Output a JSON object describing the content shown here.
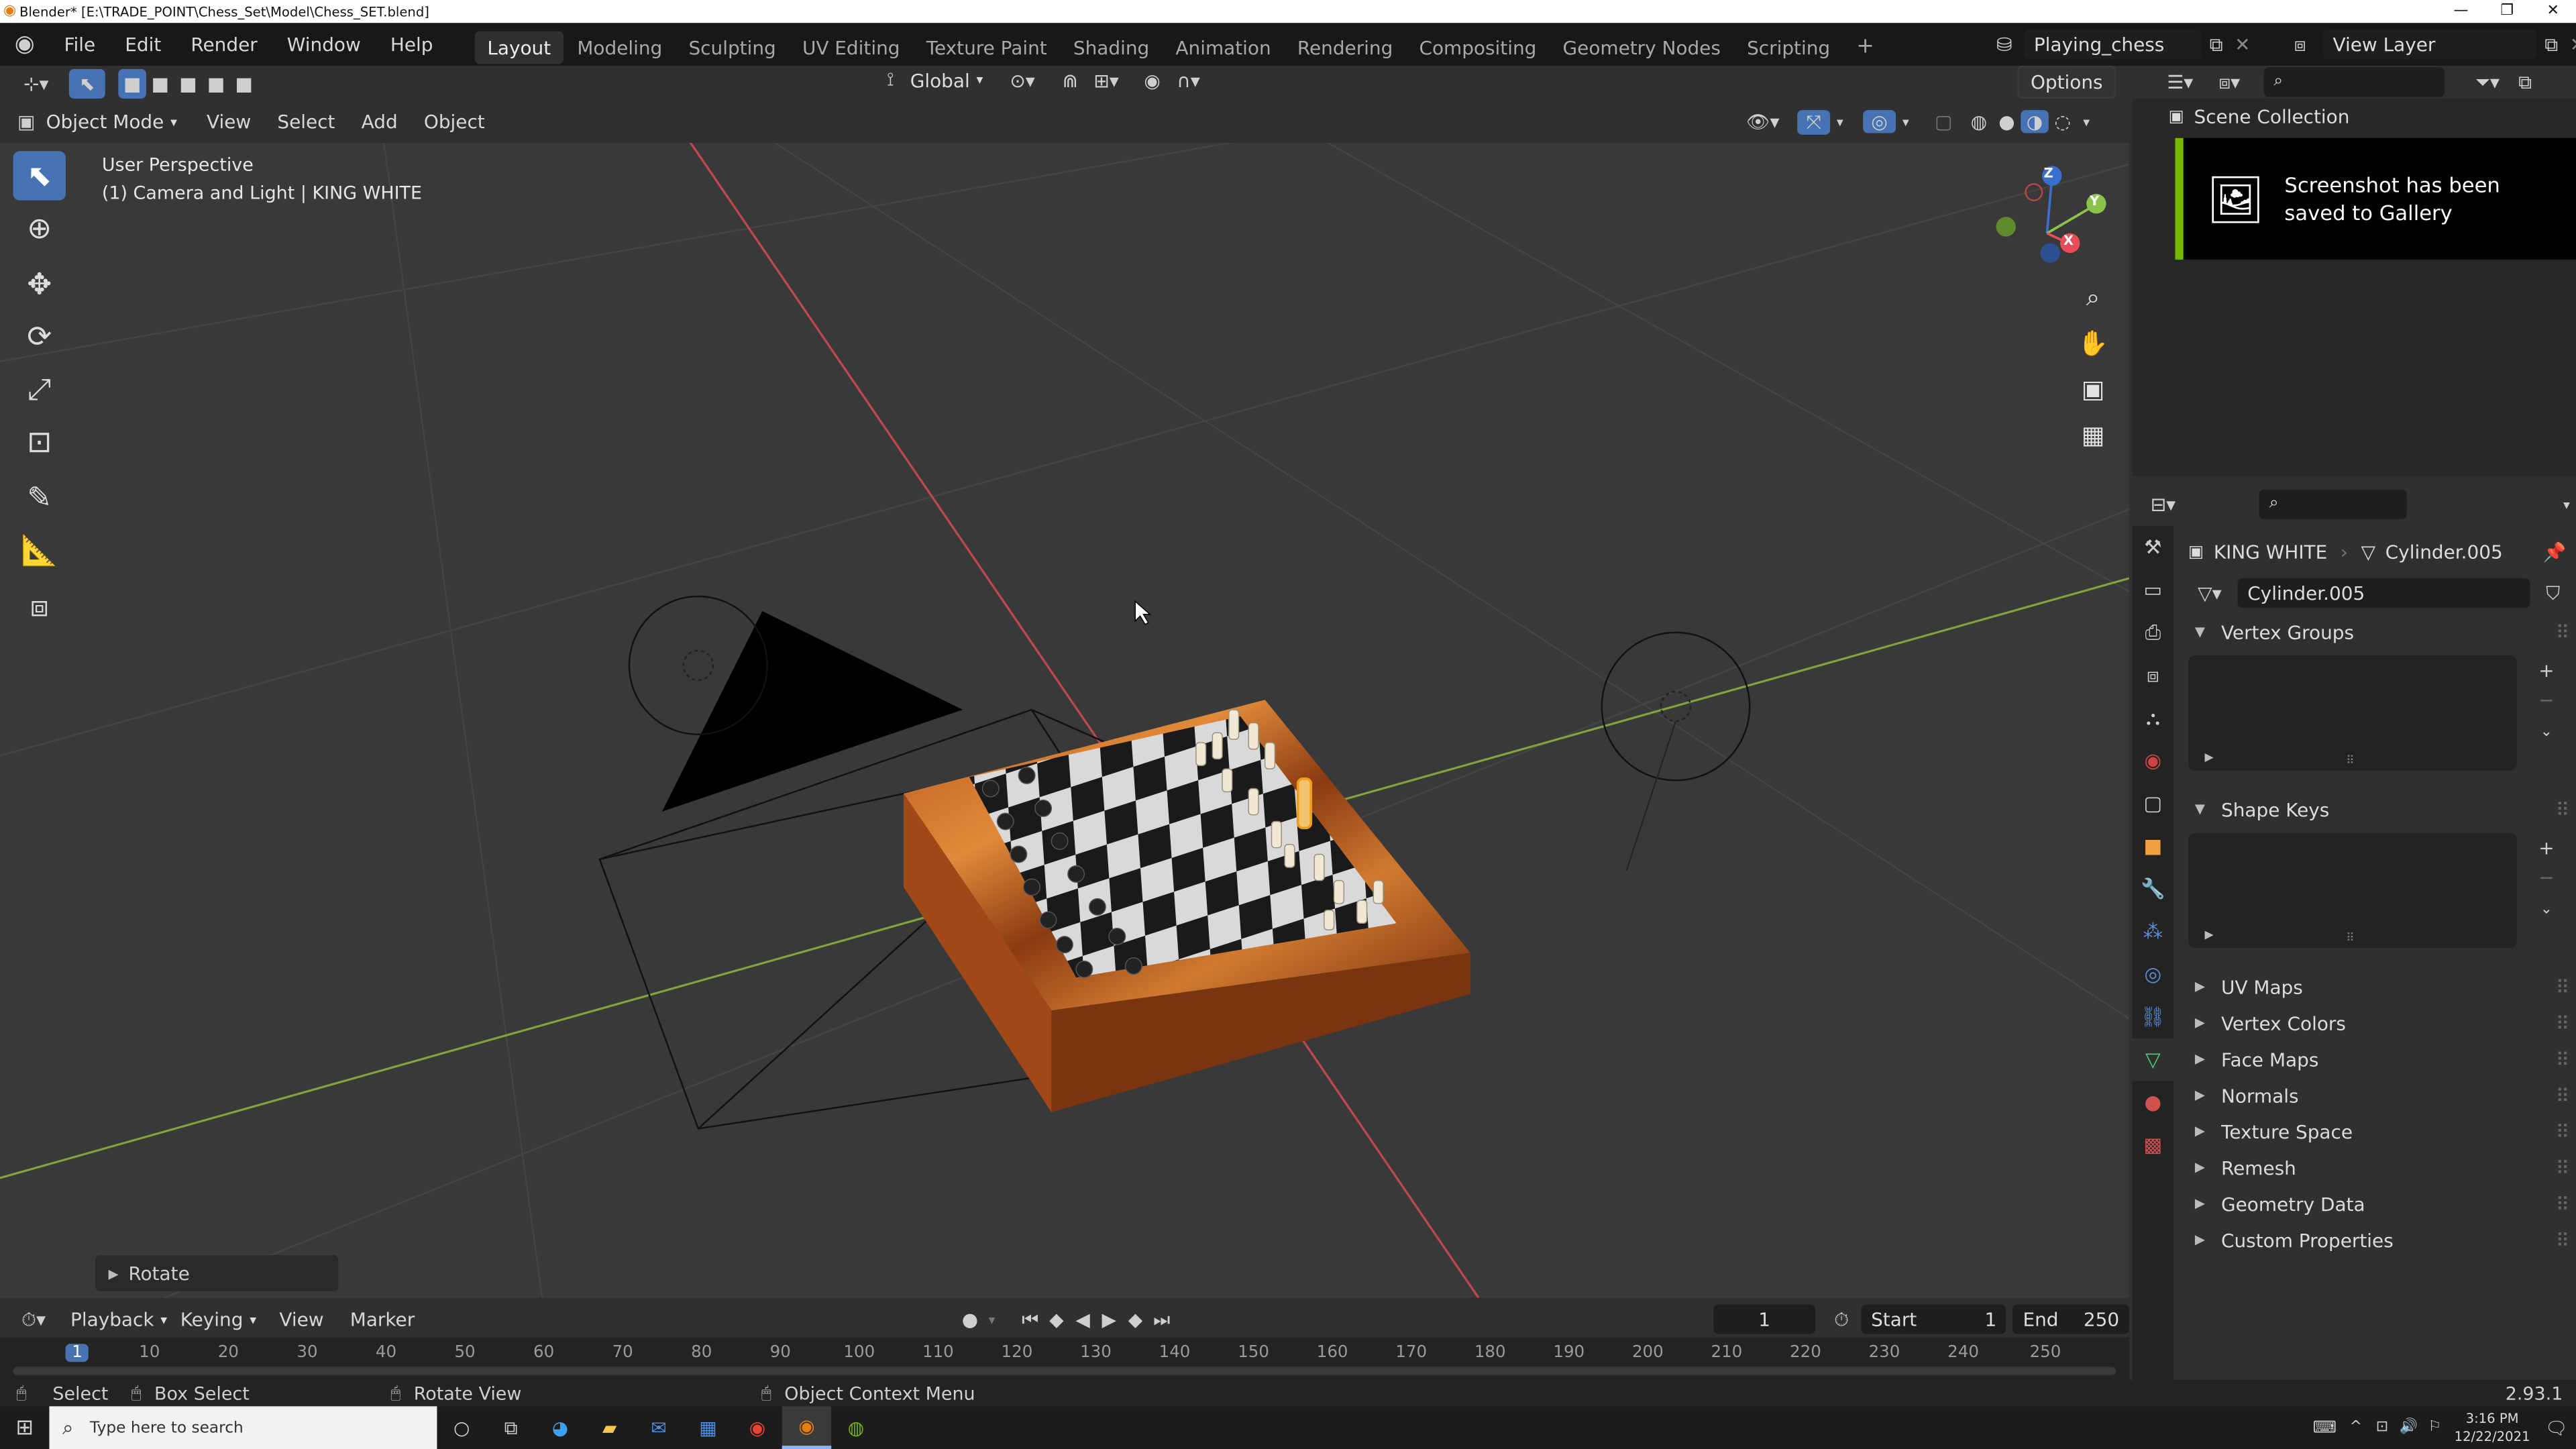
{
  "window": {
    "title": "Blender* [E:\\TRADE_POINT\\Chess_Set\\Model\\Chess_SET.blend]",
    "controls": [
      "—",
      "❐",
      "✕"
    ]
  },
  "menu": {
    "items": [
      "File",
      "Edit",
      "Render",
      "Window",
      "Help"
    ]
  },
  "workspaces": {
    "tabs": [
      "Layout",
      "Modeling",
      "Sculpting",
      "UV Editing",
      "Texture Paint",
      "Shading",
      "Animation",
      "Rendering",
      "Compositing",
      "Geometry Nodes",
      "Scripting"
    ],
    "active": "Layout",
    "add": "+"
  },
  "scene": {
    "name": "Playing_chess"
  },
  "view_layer": {
    "name": "View Layer"
  },
  "viewport_header": {
    "transform_orientation": "Global",
    "options": "Options",
    "mode": "Object Mode",
    "menus": [
      "View",
      "Select",
      "Add",
      "Object"
    ]
  },
  "viewport": {
    "perspective": "User Perspective",
    "context": "(1) Camera and Light | KING WHITE",
    "operator_panel": "Rotate",
    "gizmo": {
      "z": "Z",
      "y": "Y",
      "x": "X"
    }
  },
  "outliner": {
    "title": "Scene Collection"
  },
  "notification": {
    "text": "Screenshot has been saved to Gallery",
    "accent": "#76b900"
  },
  "properties": {
    "object_name": "KING WHITE",
    "mesh_name": "Cylinder.005",
    "datablock": "Cylinder.005",
    "panels_open": [
      "Vertex Groups",
      "Shape Keys"
    ],
    "panels_closed": [
      "UV Maps",
      "Vertex Colors",
      "Face Maps",
      "Normals",
      "Texture Space",
      "Remesh",
      "Geometry Data",
      "Custom Properties"
    ]
  },
  "timeline": {
    "menus": [
      "Playback",
      "Keying",
      "View",
      "Marker"
    ],
    "current_frame": "1",
    "start_label": "Start",
    "start": "1",
    "end_label": "End",
    "end": "250",
    "ruler": [
      "1",
      "10",
      "20",
      "30",
      "40",
      "50",
      "60",
      "70",
      "80",
      "90",
      "100",
      "110",
      "120",
      "130",
      "140",
      "150",
      "160",
      "170",
      "180",
      "190",
      "200",
      "210",
      "220",
      "230",
      "240",
      "250"
    ]
  },
  "statusbar": {
    "select": "Select",
    "box_select": "Box Select",
    "rotate_view": "Rotate View",
    "context_menu": "Object Context Menu",
    "version": "2.93.1"
  },
  "taskbar": {
    "search_placeholder": "Type here to search",
    "time": "3:16 PM",
    "date": "12/22/2021"
  },
  "colors": {
    "accent_blue": "#4772b3",
    "axis_x": "#e74c57",
    "axis_y": "#8bc34a"
  }
}
